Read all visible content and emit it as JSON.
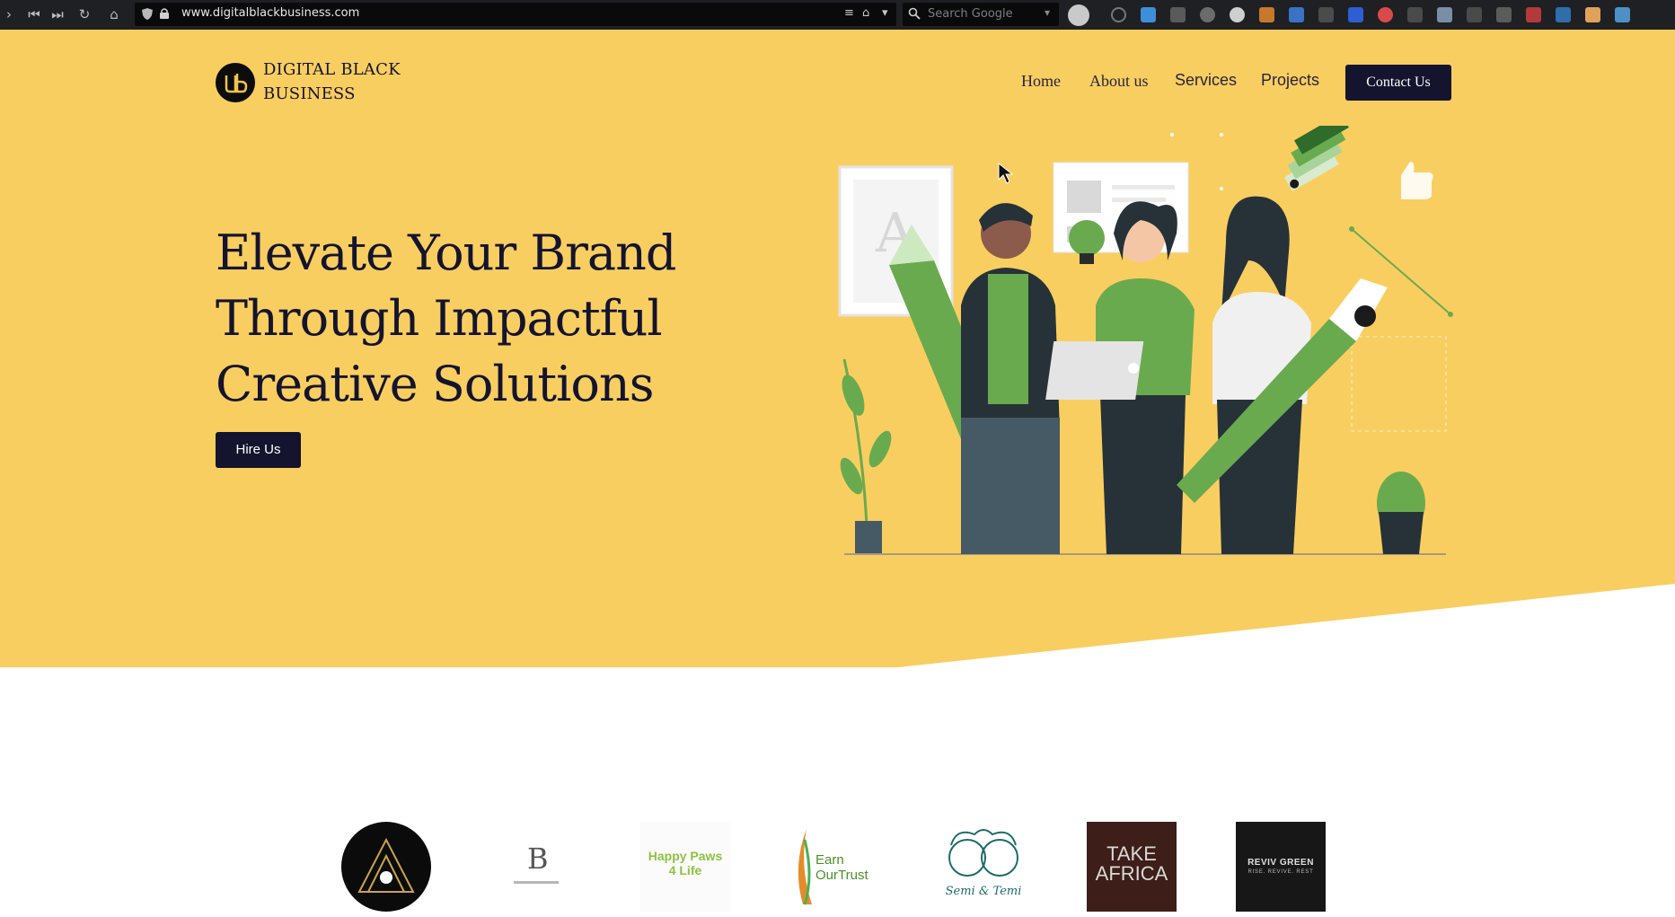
{
  "browser": {
    "url": "www.digitalblackbusiness.com",
    "search_placeholder": "Search Google",
    "nav_icons": [
      "chevron-right-icon",
      "first-page-icon",
      "last-page-icon",
      "reload-icon",
      "home-icon"
    ],
    "url_actions": [
      "reader-icon",
      "bookmark-icon",
      "dropdown-icon"
    ],
    "extension_icons": [
      "ext-1",
      "ext-2",
      "ext-3",
      "ext-4",
      "ext-5",
      "ext-6",
      "ext-7",
      "ext-8",
      "ext-9",
      "ext-10",
      "ext-11",
      "ext-12",
      "ext-13",
      "ext-14",
      "ext-15",
      "ext-16",
      "ext-17",
      "ext-18"
    ]
  },
  "site": {
    "logo": {
      "line1": "DIGITAL BLACK",
      "line2": "BUSINESS"
    },
    "nav": [
      "Home",
      "About us",
      "Services",
      "Projects"
    ],
    "contact_label": "Contact Us",
    "hero": {
      "line1": "Elevate Your Brand",
      "line2": "Through Impactful",
      "line3": "Creative Solutions",
      "cta": "Hire Us",
      "illustration_letter": "A"
    },
    "partners": [
      {
        "name": "partner-logo-circle",
        "text": ""
      },
      {
        "name": "partner-logo-b",
        "text": "B"
      },
      {
        "name": "partner-logo-happy-paws",
        "text": "Happy Paws 4 Life"
      },
      {
        "name": "partner-logo-earn-our-trust",
        "text": "Earn OurTrust"
      },
      {
        "name": "partner-logo-semi-temi",
        "text": "Semi & Temi"
      },
      {
        "name": "partner-logo-take-africa",
        "text": "TAKE AFRICA"
      },
      {
        "name": "partner-logo-reviv-green",
        "text": "REVIV GREEN",
        "subtext": "RISE. REVIVE. REST"
      }
    ]
  },
  "colors": {
    "hero_bg": "#f9ce60",
    "navy": "#14142e",
    "green": "#6aaa4f",
    "chrome": "#1f2023"
  }
}
